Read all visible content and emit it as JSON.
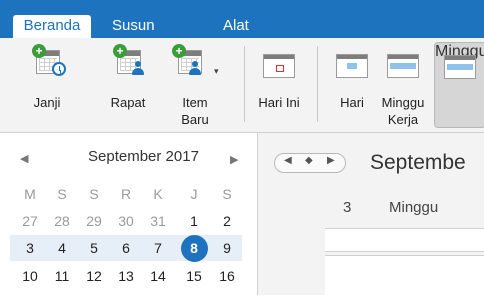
{
  "tabs": {
    "beranda": "Beranda",
    "susun": "Susun",
    "alat": "Alat"
  },
  "ribbon": {
    "janji": "Janji",
    "rapat": "Rapat",
    "item_baru_line1": "Item",
    "item_baru_line2": "Baru",
    "hari_ini": "Hari Ini",
    "hari": "Hari",
    "minggu_kerja_line1": "Minggu",
    "minggu_kerja_line2": "Kerja",
    "minggu": "Minggu",
    "dropdown_glyph": "▾"
  },
  "mini_calendar": {
    "month_year": "September 2017",
    "prev_glyph": "◀",
    "next_glyph": "▶",
    "weekdays": [
      "M",
      "S",
      "S",
      "R",
      "K",
      "J",
      "S"
    ],
    "rows": [
      [
        "27",
        "28",
        "29",
        "30",
        "31",
        "1",
        "2"
      ],
      [
        "3",
        "4",
        "5",
        "6",
        "7",
        "8",
        "9"
      ],
      [
        "10",
        "11",
        "12",
        "13",
        "14",
        "15",
        "16"
      ]
    ],
    "today": "8",
    "colors": {
      "muted": "#9a9a9a",
      "normal": "#222222",
      "today_bg": "#1e73be",
      "today_text": "#ffffff",
      "week_highlight": "#e6eef8"
    }
  },
  "calendar_view": {
    "nav_prev": "◀",
    "nav_today": "◆",
    "nav_next": "▶",
    "title": "Septembe",
    "week_number": "3",
    "column_label": "Minggu"
  },
  "colors": {
    "accent": "#1e73be",
    "ribbon_bg": "#f3f3f3",
    "plus_green": "#3a9d3a"
  }
}
